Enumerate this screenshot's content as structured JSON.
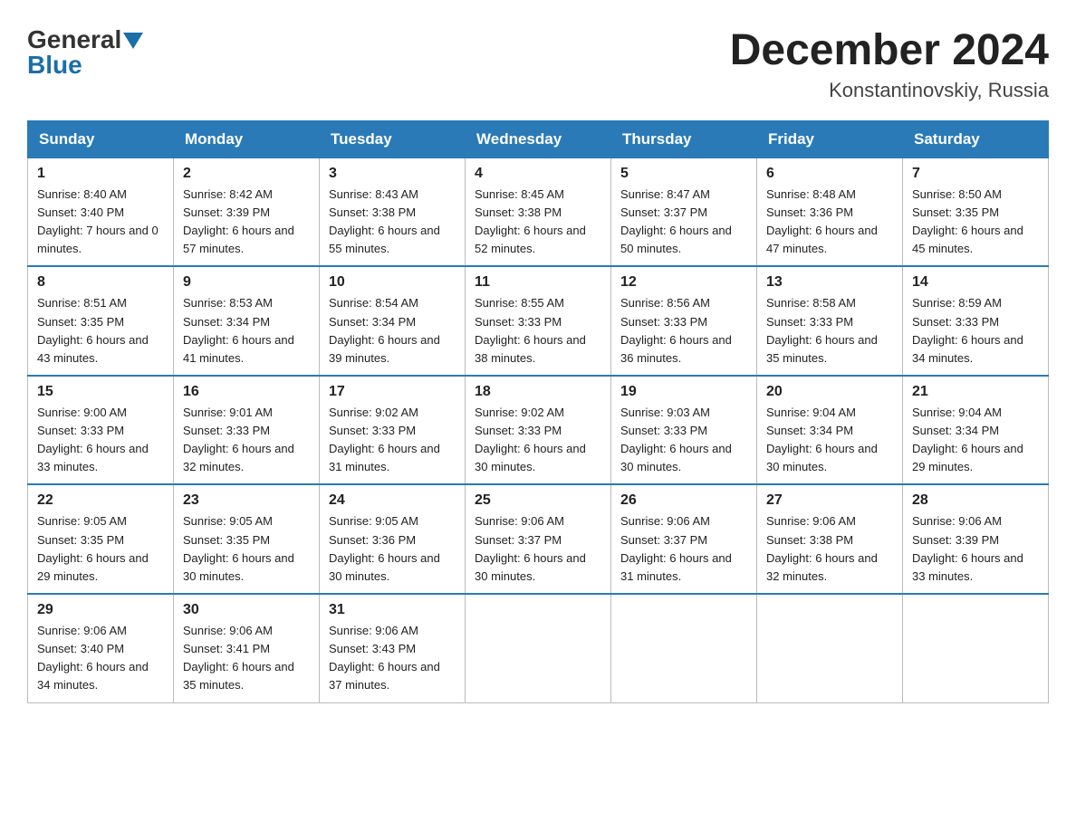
{
  "header": {
    "logo_general": "General",
    "logo_blue": "Blue",
    "month_title": "December 2024",
    "location": "Konstantinovskiy, Russia"
  },
  "days_of_week": [
    "Sunday",
    "Monday",
    "Tuesday",
    "Wednesday",
    "Thursday",
    "Friday",
    "Saturday"
  ],
  "weeks": [
    [
      {
        "day": "1",
        "sunrise": "8:40 AM",
        "sunset": "3:40 PM",
        "daylight": "7 hours and 0 minutes."
      },
      {
        "day": "2",
        "sunrise": "8:42 AM",
        "sunset": "3:39 PM",
        "daylight": "6 hours and 57 minutes."
      },
      {
        "day": "3",
        "sunrise": "8:43 AM",
        "sunset": "3:38 PM",
        "daylight": "6 hours and 55 minutes."
      },
      {
        "day": "4",
        "sunrise": "8:45 AM",
        "sunset": "3:38 PM",
        "daylight": "6 hours and 52 minutes."
      },
      {
        "day": "5",
        "sunrise": "8:47 AM",
        "sunset": "3:37 PM",
        "daylight": "6 hours and 50 minutes."
      },
      {
        "day": "6",
        "sunrise": "8:48 AM",
        "sunset": "3:36 PM",
        "daylight": "6 hours and 47 minutes."
      },
      {
        "day": "7",
        "sunrise": "8:50 AM",
        "sunset": "3:35 PM",
        "daylight": "6 hours and 45 minutes."
      }
    ],
    [
      {
        "day": "8",
        "sunrise": "8:51 AM",
        "sunset": "3:35 PM",
        "daylight": "6 hours and 43 minutes."
      },
      {
        "day": "9",
        "sunrise": "8:53 AM",
        "sunset": "3:34 PM",
        "daylight": "6 hours and 41 minutes."
      },
      {
        "day": "10",
        "sunrise": "8:54 AM",
        "sunset": "3:34 PM",
        "daylight": "6 hours and 39 minutes."
      },
      {
        "day": "11",
        "sunrise": "8:55 AM",
        "sunset": "3:33 PM",
        "daylight": "6 hours and 38 minutes."
      },
      {
        "day": "12",
        "sunrise": "8:56 AM",
        "sunset": "3:33 PM",
        "daylight": "6 hours and 36 minutes."
      },
      {
        "day": "13",
        "sunrise": "8:58 AM",
        "sunset": "3:33 PM",
        "daylight": "6 hours and 35 minutes."
      },
      {
        "day": "14",
        "sunrise": "8:59 AM",
        "sunset": "3:33 PM",
        "daylight": "6 hours and 34 minutes."
      }
    ],
    [
      {
        "day": "15",
        "sunrise": "9:00 AM",
        "sunset": "3:33 PM",
        "daylight": "6 hours and 33 minutes."
      },
      {
        "day": "16",
        "sunrise": "9:01 AM",
        "sunset": "3:33 PM",
        "daylight": "6 hours and 32 minutes."
      },
      {
        "day": "17",
        "sunrise": "9:02 AM",
        "sunset": "3:33 PM",
        "daylight": "6 hours and 31 minutes."
      },
      {
        "day": "18",
        "sunrise": "9:02 AM",
        "sunset": "3:33 PM",
        "daylight": "6 hours and 30 minutes."
      },
      {
        "day": "19",
        "sunrise": "9:03 AM",
        "sunset": "3:33 PM",
        "daylight": "6 hours and 30 minutes."
      },
      {
        "day": "20",
        "sunrise": "9:04 AM",
        "sunset": "3:34 PM",
        "daylight": "6 hours and 30 minutes."
      },
      {
        "day": "21",
        "sunrise": "9:04 AM",
        "sunset": "3:34 PM",
        "daylight": "6 hours and 29 minutes."
      }
    ],
    [
      {
        "day": "22",
        "sunrise": "9:05 AM",
        "sunset": "3:35 PM",
        "daylight": "6 hours and 29 minutes."
      },
      {
        "day": "23",
        "sunrise": "9:05 AM",
        "sunset": "3:35 PM",
        "daylight": "6 hours and 30 minutes."
      },
      {
        "day": "24",
        "sunrise": "9:05 AM",
        "sunset": "3:36 PM",
        "daylight": "6 hours and 30 minutes."
      },
      {
        "day": "25",
        "sunrise": "9:06 AM",
        "sunset": "3:37 PM",
        "daylight": "6 hours and 30 minutes."
      },
      {
        "day": "26",
        "sunrise": "9:06 AM",
        "sunset": "3:37 PM",
        "daylight": "6 hours and 31 minutes."
      },
      {
        "day": "27",
        "sunrise": "9:06 AM",
        "sunset": "3:38 PM",
        "daylight": "6 hours and 32 minutes."
      },
      {
        "day": "28",
        "sunrise": "9:06 AM",
        "sunset": "3:39 PM",
        "daylight": "6 hours and 33 minutes."
      }
    ],
    [
      {
        "day": "29",
        "sunrise": "9:06 AM",
        "sunset": "3:40 PM",
        "daylight": "6 hours and 34 minutes."
      },
      {
        "day": "30",
        "sunrise": "9:06 AM",
        "sunset": "3:41 PM",
        "daylight": "6 hours and 35 minutes."
      },
      {
        "day": "31",
        "sunrise": "9:06 AM",
        "sunset": "3:43 PM",
        "daylight": "6 hours and 37 minutes."
      },
      null,
      null,
      null,
      null
    ]
  ],
  "labels": {
    "sunrise": "Sunrise:",
    "sunset": "Sunset:",
    "daylight": "Daylight:"
  }
}
